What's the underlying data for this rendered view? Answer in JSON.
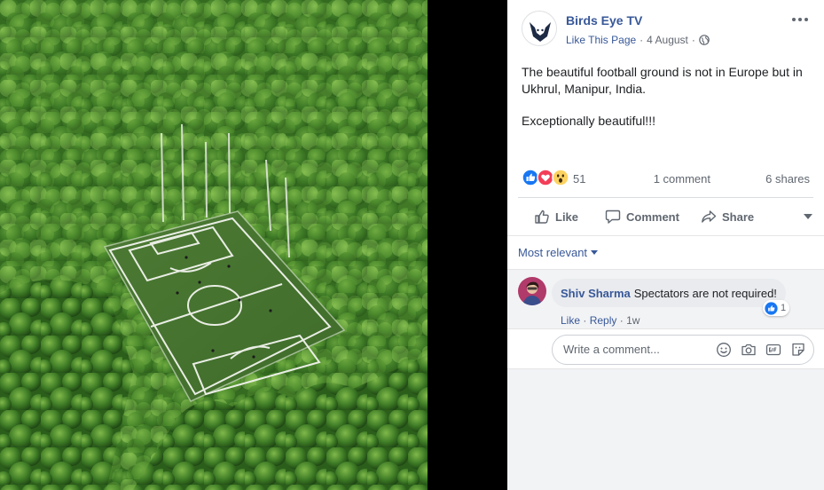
{
  "post": {
    "page_name": "Birds Eye TV",
    "like_page_label": "Like This Page",
    "separator": "·",
    "date": "4 August",
    "text_paragraphs": [
      "The beautiful football ground is not in Europe but in Ukhrul, Manipur, India.",
      "Exceptionally beautiful!!!"
    ],
    "reactions": {
      "icons": [
        "like-icon",
        "love-icon",
        "wow-icon"
      ],
      "count": "51"
    },
    "comments_label": "1 comment",
    "shares_label": "6 shares",
    "photo_alt_icon": "forest-football-field-photo"
  },
  "actions": {
    "like": "Like",
    "comment": "Comment",
    "share": "Share"
  },
  "comments": {
    "sort_label": "Most relevant",
    "items": [
      {
        "author": "Shiv Sharma",
        "text": "Spectators are not required!",
        "like_label": "Like",
        "reply_label": "Reply",
        "time": "1w",
        "reaction_count": "1"
      }
    ],
    "composer_placeholder": "Write a comment...",
    "composer_tools": [
      "emoji-icon",
      "camera-icon",
      "gif-icon",
      "sticker-icon"
    ]
  },
  "colors": {
    "link": "#385898",
    "like_blue": "#1877f2",
    "love_red": "#f33e58",
    "wow_yellow": "#fcd360"
  }
}
